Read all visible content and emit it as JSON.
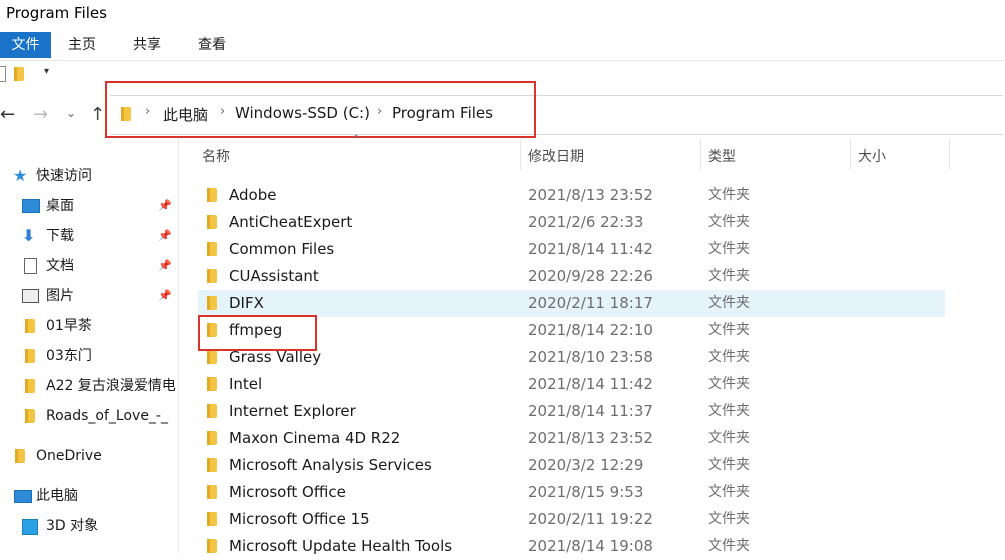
{
  "window": {
    "title": "Program Files"
  },
  "ribbon": {
    "tabs": [
      "文件",
      "主页",
      "共享",
      "查看"
    ]
  },
  "quick_access": {
    "dropdown": "▾"
  },
  "nav": {
    "back": "←",
    "forward": "→",
    "recent": "⌄",
    "up": "↑"
  },
  "address": {
    "crumbs": [
      "此电脑",
      "Windows-SSD (C:)",
      "Program Files"
    ],
    "separator": "›"
  },
  "sidebar": {
    "items": [
      {
        "label": "快速访问",
        "icon": "star-icon",
        "pinned": false
      },
      {
        "label": "桌面",
        "icon": "desktop-icon",
        "pinned": true
      },
      {
        "label": "下载",
        "icon": "download-icon",
        "pinned": true
      },
      {
        "label": "文档",
        "icon": "document-icon",
        "pinned": true
      },
      {
        "label": "图片",
        "icon": "pictures-icon",
        "pinned": true
      },
      {
        "label": "01早茶",
        "icon": "folder-icon",
        "pinned": false
      },
      {
        "label": "03东门",
        "icon": "folder-icon",
        "pinned": false
      },
      {
        "label": "A22 复古浪漫爱情电",
        "icon": "folder-icon",
        "pinned": false
      },
      {
        "label": "Roads_of_Love_-_",
        "icon": "folder-icon",
        "pinned": false
      },
      {
        "label": "OneDrive",
        "icon": "onedrive-folder-icon",
        "pinned": false
      },
      {
        "label": "此电脑",
        "icon": "this-pc-icon",
        "pinned": false
      },
      {
        "label": "3D 对象",
        "icon": "3d-objects-icon",
        "pinned": false
      }
    ],
    "pin_glyph": "📌"
  },
  "columns": {
    "name": "名称",
    "date": "修改日期",
    "type": "类型",
    "size": "大小",
    "sort_glyph": "^"
  },
  "files": [
    {
      "name": "Adobe",
      "date": "2021/8/13 23:52",
      "type": "文件夹"
    },
    {
      "name": "AntiCheatExpert",
      "date": "2021/2/6 22:33",
      "type": "文件夹"
    },
    {
      "name": "Common Files",
      "date": "2021/8/14 11:42",
      "type": "文件夹"
    },
    {
      "name": "CUAssistant",
      "date": "2020/9/28 22:26",
      "type": "文件夹"
    },
    {
      "name": "DIFX",
      "date": "2020/2/11 18:17",
      "type": "文件夹",
      "selected": true
    },
    {
      "name": "ffmpeg",
      "date": "2021/8/14 22:10",
      "type": "文件夹"
    },
    {
      "name": "Grass Valley",
      "date": "2021/8/10 23:58",
      "type": "文件夹"
    },
    {
      "name": "Intel",
      "date": "2021/8/14 11:42",
      "type": "文件夹"
    },
    {
      "name": "Internet Explorer",
      "date": "2021/8/14 11:37",
      "type": "文件夹"
    },
    {
      "name": "Maxon Cinema 4D R22",
      "date": "2021/8/13 23:52",
      "type": "文件夹"
    },
    {
      "name": "Microsoft Analysis Services",
      "date": "2020/3/2 12:29",
      "type": "文件夹"
    },
    {
      "name": "Microsoft Office",
      "date": "2021/8/15 9:53",
      "type": "文件夹"
    },
    {
      "name": "Microsoft Office 15",
      "date": "2020/2/11 19:22",
      "type": "文件夹"
    },
    {
      "name": "Microsoft Update Health Tools",
      "date": "2021/8/14 19:08",
      "type": "文件夹"
    }
  ],
  "colors": {
    "accent": "#1a73c9",
    "selection": "#e5f3fb",
    "highlight": "#d9342b",
    "folder": "#f4c542"
  }
}
